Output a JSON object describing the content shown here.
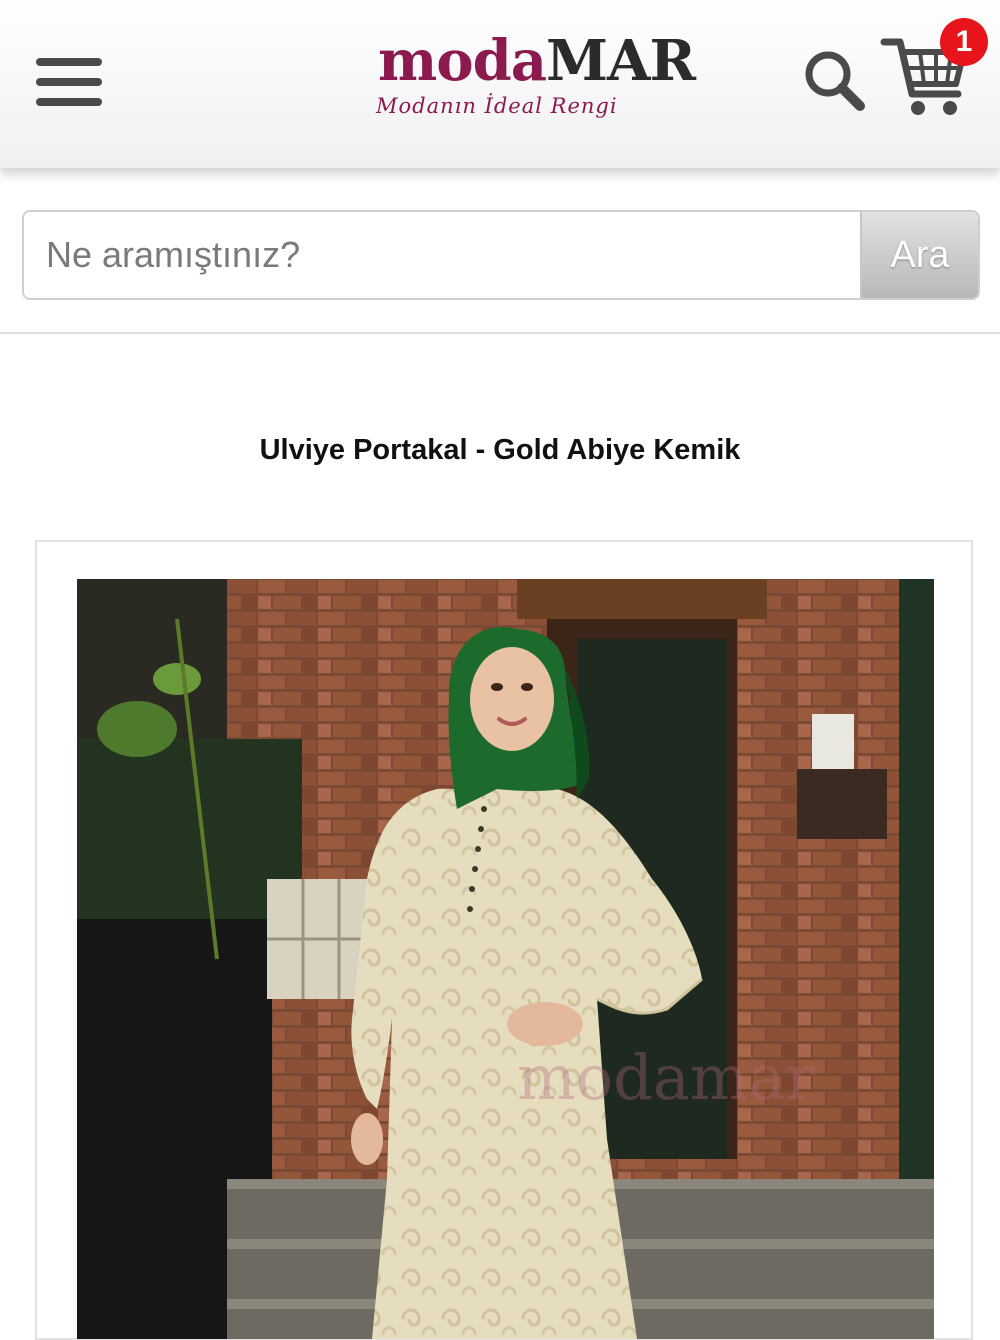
{
  "header": {
    "menu_icon": "hamburger-menu-icon",
    "logo": {
      "text_moda": "moda",
      "text_mar": "MAR",
      "tagline": "Modanın İdeal Rengi",
      "color_primary": "#8b1a4f",
      "color_secondary": "#2b2b2b"
    },
    "search_icon": "search-icon",
    "cart_icon": "cart-icon",
    "cart_count": "1",
    "badge_color": "#e8141b"
  },
  "search": {
    "placeholder": "Ne aramıştınız?",
    "button_label": "Ara"
  },
  "product": {
    "title": "Ulviye Portakal - Gold Abiye Kemik",
    "image_watermark": "modamar"
  }
}
